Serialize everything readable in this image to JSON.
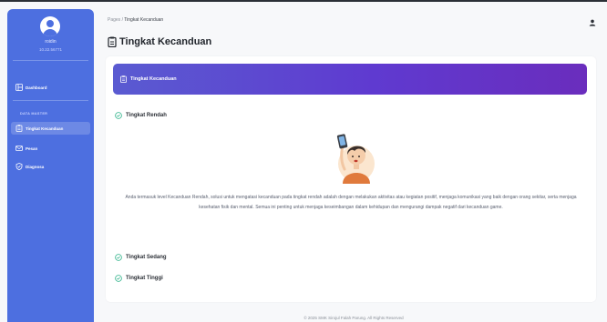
{
  "sidebar": {
    "user_name": "roidin",
    "user_id": "10.22.56771",
    "section_label": "DATA MASTER",
    "items": [
      {
        "label": "Dashboard",
        "icon": "dashboard-icon"
      },
      {
        "label": "Tingkat Kecanduan",
        "icon": "clipboard-icon"
      },
      {
        "label": "Pesan",
        "icon": "message-icon"
      },
      {
        "label": "Diagnosa",
        "icon": "shield-icon"
      }
    ]
  },
  "header": {
    "breadcrumb_root": "Pages",
    "breadcrumb_sep": "/",
    "breadcrumb_current": "Tingkat Kecanduan",
    "page_title": "Tingkat Kecanduan"
  },
  "card": {
    "banner_title": "Tingkat Kecanduan",
    "levels": [
      {
        "label": "Tingkat Rendah",
        "expanded": true
      },
      {
        "label": "Tingkat Sedang",
        "expanded": false
      },
      {
        "label": "Tingkat Tinggi",
        "expanded": false
      }
    ],
    "description": "Anda termasuk level Kecanduan Rendah, solusi untuk mengatasi kecanduan pada tingkat rendah adalah dengan melakukan aktivitas atau kegiatan positif, menjaga komunikasi yang baik dengan orang sekitar, serta menjaga kesehatan fisik dan mental. Semua ini penting untuk menjaga keseimbangan dalam kehidupan dan mengurangi dampak negatif dari kecanduan game."
  },
  "footer": {
    "text": "© 2025 SMK Sirojul Falah Parung. All Rights Reserved"
  },
  "colors": {
    "sidebar": "#4d6fe0",
    "banner_start": "#5a5bd1",
    "banner_end": "#6a2dbd",
    "check": "#2fb38a"
  }
}
